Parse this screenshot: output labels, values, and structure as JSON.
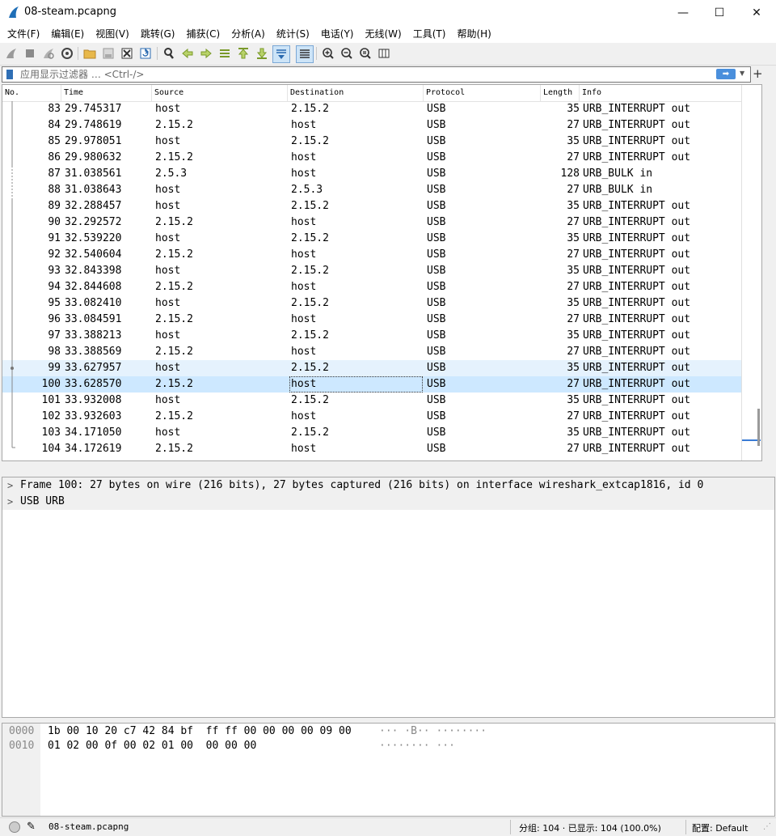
{
  "window": {
    "title": "08-steam.pcapng",
    "minimize": "—",
    "maximize": "☐",
    "close": "✕"
  },
  "menu": [
    "文件(F)",
    "编辑(E)",
    "视图(V)",
    "跳转(G)",
    "捕获(C)",
    "分析(A)",
    "统计(S)",
    "电话(Y)",
    "无线(W)",
    "工具(T)",
    "帮助(H)"
  ],
  "toolbar": {
    "icons": [
      "shark-fin-start-icon",
      "stop-square-icon",
      "restart-fin-icon",
      "capture-options-gear-icon",
      "open-folder-icon",
      "save-file-icon",
      "close-file-icon",
      "reload-file-icon",
      "find-packet-magnifier-icon",
      "go-back-arrow-icon",
      "go-forward-arrow-icon",
      "go-to-packet-icon",
      "go-first-packet-icon",
      "go-last-packet-icon",
      "autoscroll-icon",
      "colorize-icon",
      "zoom-in-icon",
      "zoom-out-icon",
      "normal-size-icon",
      "resize-columns-icon"
    ]
  },
  "filter": {
    "placeholder": "应用显示过滤器 … <Ctrl-/>",
    "value": ""
  },
  "packet_list": {
    "columns": [
      "No.",
      "Time",
      "Source",
      "Destination",
      "Protocol",
      "Length",
      "Info"
    ],
    "rows": [
      {
        "no": "83",
        "time": "29.745317",
        "source": "host",
        "destination": "2.15.2",
        "protocol": "USB",
        "length": "35",
        "info": "URB_INTERRUPT out"
      },
      {
        "no": "84",
        "time": "29.748619",
        "source": "2.15.2",
        "destination": "host",
        "protocol": "USB",
        "length": "27",
        "info": "URB_INTERRUPT out"
      },
      {
        "no": "85",
        "time": "29.978051",
        "source": "host",
        "destination": "2.15.2",
        "protocol": "USB",
        "length": "35",
        "info": "URB_INTERRUPT out"
      },
      {
        "no": "86",
        "time": "29.980632",
        "source": "2.15.2",
        "destination": "host",
        "protocol": "USB",
        "length": "27",
        "info": "URB_INTERRUPT out"
      },
      {
        "no": "87",
        "time": "31.038561",
        "source": "2.5.3",
        "destination": "host",
        "protocol": "USB",
        "length": "128",
        "info": "URB_BULK in"
      },
      {
        "no": "88",
        "time": "31.038643",
        "source": "host",
        "destination": "2.5.3",
        "protocol": "USB",
        "length": "27",
        "info": "URB_BULK in"
      },
      {
        "no": "89",
        "time": "32.288457",
        "source": "host",
        "destination": "2.15.2",
        "protocol": "USB",
        "length": "35",
        "info": "URB_INTERRUPT out"
      },
      {
        "no": "90",
        "time": "32.292572",
        "source": "2.15.2",
        "destination": "host",
        "protocol": "USB",
        "length": "27",
        "info": "URB_INTERRUPT out"
      },
      {
        "no": "91",
        "time": "32.539220",
        "source": "host",
        "destination": "2.15.2",
        "protocol": "USB",
        "length": "35",
        "info": "URB_INTERRUPT out"
      },
      {
        "no": "92",
        "time": "32.540604",
        "source": "2.15.2",
        "destination": "host",
        "protocol": "USB",
        "length": "27",
        "info": "URB_INTERRUPT out"
      },
      {
        "no": "93",
        "time": "32.843398",
        "source": "host",
        "destination": "2.15.2",
        "protocol": "USB",
        "length": "35",
        "info": "URB_INTERRUPT out"
      },
      {
        "no": "94",
        "time": "32.844608",
        "source": "2.15.2",
        "destination": "host",
        "protocol": "USB",
        "length": "27",
        "info": "URB_INTERRUPT out"
      },
      {
        "no": "95",
        "time": "33.082410",
        "source": "host",
        "destination": "2.15.2",
        "protocol": "USB",
        "length": "35",
        "info": "URB_INTERRUPT out"
      },
      {
        "no": "96",
        "time": "33.084591",
        "source": "2.15.2",
        "destination": "host",
        "protocol": "USB",
        "length": "27",
        "info": "URB_INTERRUPT out"
      },
      {
        "no": "97",
        "time": "33.388213",
        "source": "host",
        "destination": "2.15.2",
        "protocol": "USB",
        "length": "35",
        "info": "URB_INTERRUPT out"
      },
      {
        "no": "98",
        "time": "33.388569",
        "source": "2.15.2",
        "destination": "host",
        "protocol": "USB",
        "length": "27",
        "info": "URB_INTERRUPT out"
      },
      {
        "no": "99",
        "time": "33.627957",
        "source": "host",
        "destination": "2.15.2",
        "protocol": "USB",
        "length": "35",
        "info": "URB_INTERRUPT out"
      },
      {
        "no": "100",
        "time": "33.628570",
        "source": "2.15.2",
        "destination": "host",
        "protocol": "USB",
        "length": "27",
        "info": "URB_INTERRUPT out"
      },
      {
        "no": "101",
        "time": "33.932008",
        "source": "host",
        "destination": "2.15.2",
        "protocol": "USB",
        "length": "35",
        "info": "URB_INTERRUPT out"
      },
      {
        "no": "102",
        "time": "33.932603",
        "source": "2.15.2",
        "destination": "host",
        "protocol": "USB",
        "length": "27",
        "info": "URB_INTERRUPT out"
      },
      {
        "no": "103",
        "time": "34.171050",
        "source": "host",
        "destination": "2.15.2",
        "protocol": "USB",
        "length": "35",
        "info": "URB_INTERRUPT out"
      },
      {
        "no": "104",
        "time": "34.172619",
        "source": "2.15.2",
        "destination": "host",
        "protocol": "USB",
        "length": "27",
        "info": "URB_INTERRUPT out"
      }
    ],
    "selected_no": "100",
    "related_no": "99"
  },
  "details": {
    "items": [
      "Frame 100: 27 bytes on wire (216 bits), 27 bytes captured (216 bits) on interface wireshark_extcap1816, id 0",
      "USB URB"
    ]
  },
  "bytes": {
    "rows": [
      {
        "offset": "0000",
        "hex": "1b 00 10 20 c7 42 84 bf  ff ff 00 00 00 00 09 00",
        "ascii": "··· ·B·· ········"
      },
      {
        "offset": "0010",
        "hex": "01 02 00 0f 00 02 01 00  00 00 00",
        "ascii": "········ ···"
      }
    ]
  },
  "status": {
    "file": "08-steam.pcapng",
    "counts": "分组: 104 · 已显示: 104 (100.0%)",
    "profile": "配置: Default"
  },
  "colors": {
    "selected_row": "#cde8ff",
    "related_row": "#e5f2fd",
    "filter_apply": "#4a8fdc"
  }
}
